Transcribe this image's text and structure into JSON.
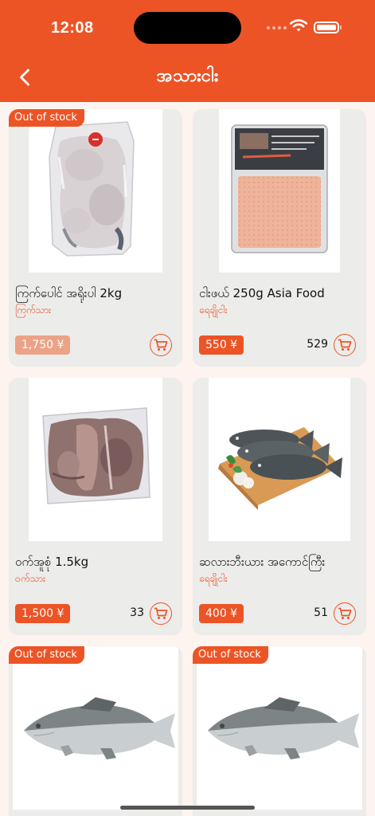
{
  "status_bar": {
    "time": "12:08"
  },
  "header": {
    "title": "အသားငါး"
  },
  "out_of_stock_label": "Out of stock",
  "products": [
    {
      "name": "ကြက်ပေါင် အရိုးပါ 2kg",
      "category": "ကြက်သား",
      "price": "1,750 ¥",
      "stock": "",
      "out_of_stock": true,
      "image": "frozen-chicken-pack"
    },
    {
      "name": "ငါးဖယ် 250g Asia Food",
      "category": "ရေချိုငါး",
      "price": "550 ¥",
      "stock": "529",
      "out_of_stock": false,
      "image": "fish-paste-pack"
    },
    {
      "name": "ဝက်အူစုံ 1.5kg",
      "category": "ဝက်သား",
      "price": "1,500 ¥",
      "stock": "33",
      "out_of_stock": false,
      "image": "frozen-pork-pack"
    },
    {
      "name": "ဆလားဘီးယား အကောင်ကြီး",
      "category": "ရေချိုငါး",
      "price": "400 ¥",
      "stock": "51",
      "out_of_stock": false,
      "image": "tilapia-on-board"
    },
    {
      "name": "",
      "category": "",
      "price": "",
      "stock": "",
      "out_of_stock": true,
      "image": "barramundi-fish"
    },
    {
      "name": "",
      "category": "",
      "price": "",
      "stock": "",
      "out_of_stock": true,
      "image": "barramundi-fish"
    }
  ],
  "colors": {
    "accent": "#ec5426",
    "accent_faded": "#eca287",
    "background": "#fdf3ef",
    "card": "#ececea"
  }
}
